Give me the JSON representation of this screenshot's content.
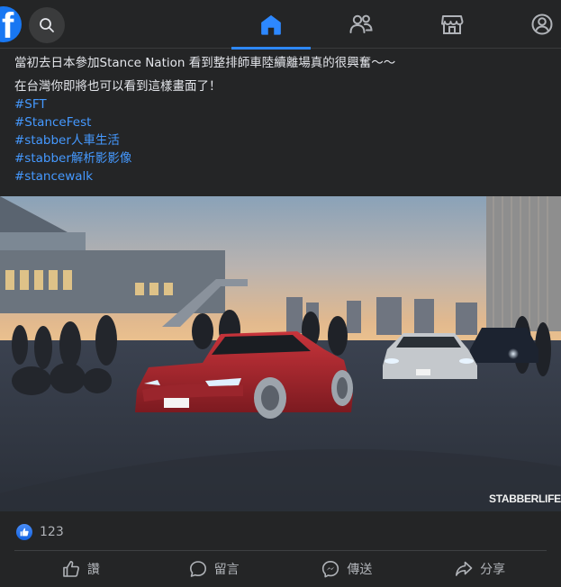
{
  "nav": {
    "logo_letter": "f",
    "tabs": [
      {
        "name": "home-icon",
        "active": true
      },
      {
        "name": "friends-icon",
        "active": false
      },
      {
        "name": "marketplace-icon",
        "active": false
      },
      {
        "name": "profile-icon",
        "active": false
      }
    ]
  },
  "post": {
    "line1": "當初去日本參加Stance Nation  看到整排師車陸續離場真的很興奮～～",
    "line2": "在台灣你即將也可以看到這樣畫面了！",
    "hashtags": [
      "#SFT",
      "#StanceFest",
      "#stabber人車生活",
      "#stabber解析影影像",
      "#stancewalk"
    ],
    "photo_watermark": "STABBERLIFE"
  },
  "reactions": {
    "count": "123"
  },
  "actions": {
    "like": "讚",
    "comment": "留言",
    "send": "傳送",
    "share": "分享"
  },
  "colors": {
    "accent": "#2d88ff",
    "link": "#4599ff",
    "background": "#242526"
  }
}
